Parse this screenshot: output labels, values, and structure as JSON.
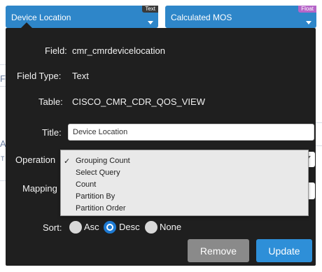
{
  "chips": [
    {
      "label": "Device Location",
      "badge": "Text",
      "badge_color": "#3a3a3a"
    },
    {
      "label": "Calculated MOS",
      "badge": "Float",
      "badge_color": "#b565c8"
    }
  ],
  "background": {
    "letters": [
      "F",
      "A",
      "T"
    ]
  },
  "popover": {
    "field_label": "Field:",
    "field_value": "cmr_cmrdevicelocation",
    "field_type_label": "Field Type:",
    "field_type_value": "Text",
    "table_label": "Table:",
    "table_value": "CISCO_CMR_CDR_QOS_VIEW",
    "title_label": "Title:",
    "title_value": "Device Location",
    "operation_label": "Operation",
    "operation_options": [
      "Grouping Count",
      "Select Query",
      "Count",
      "Partition By",
      "Partition Order"
    ],
    "operation_selected": "Grouping Count",
    "check_mark": "✓",
    "mapping_label": "Mapping",
    "sort_label": "Sort:",
    "sort_options": [
      "Asc",
      "Desc",
      "None"
    ],
    "sort_selected": "Desc",
    "remove_label": "Remove",
    "update_label": "Update"
  },
  "colors": {
    "chip": "#2e86c9",
    "panel": "#1f1f1f",
    "accent": "#1d7ad3",
    "remove": "#8a8a8a",
    "update": "#2e8fd8"
  }
}
